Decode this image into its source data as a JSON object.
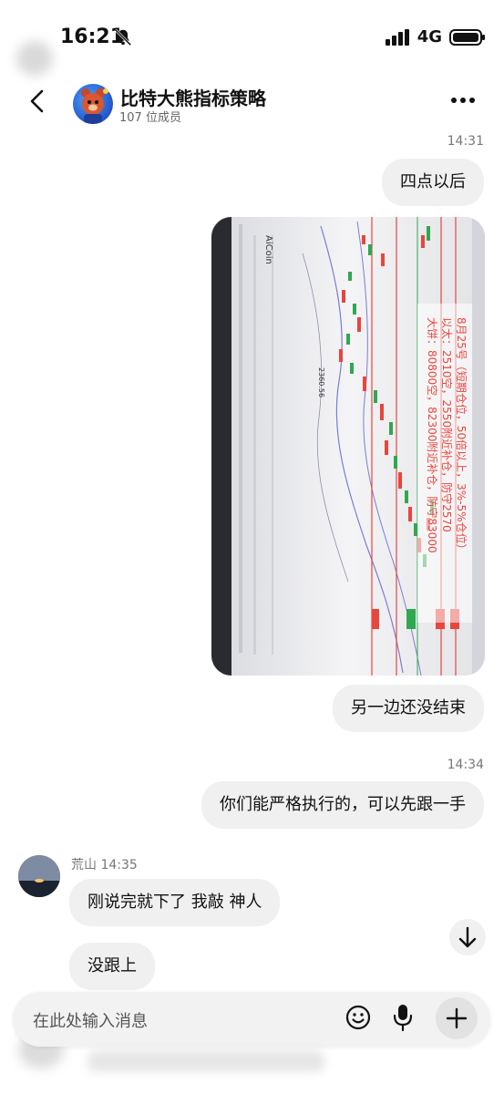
{
  "status_bar": {
    "time": "16:21",
    "network": "4G",
    "icons": [
      "bell-slash-icon",
      "signal-icon",
      "battery-icon"
    ]
  },
  "header": {
    "title": "比特大熊指标策略",
    "members": "107 位成员",
    "icons": [
      "back-icon",
      "more-icon"
    ]
  },
  "messages": {
    "ts1": "14:31",
    "m1": "四点以后",
    "m2": "另一边还没结束",
    "ts2": "14:34",
    "m3": "你们能严格执行的，可以先跟一手",
    "peer_name": "荒山 14:35",
    "m4": "刚说完就下了  我敲  神人",
    "m5": "没跟上"
  },
  "chart_photo": {
    "overlay_line1": "8月25号（短期仓位，50倍以上，3%-5%仓位）",
    "overlay_line2": "以太：2510空，2550附近补仓，防守2570",
    "overlay_line3": "大饼：80800空，82300附近补仓，防守83000",
    "level_label": "2360.56",
    "app_name": "AiCoin"
  },
  "composer": {
    "placeholder": "在此处输入消息",
    "icons": [
      "emoji-icon",
      "mic-icon",
      "plus-icon"
    ]
  },
  "colors": {
    "bubble_bg": "#f0f0f0",
    "accent_red": "#e8453c",
    "accent_green": "#2fa84f"
  }
}
